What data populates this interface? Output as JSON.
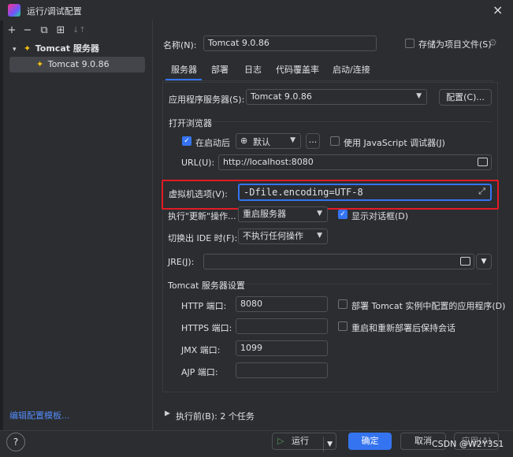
{
  "window": {
    "title": "运行/调试配置",
    "close_icon": "×"
  },
  "sidebar": {
    "toolbar": [
      "+",
      "−",
      "⧉",
      "⊞",
      "↓↑"
    ],
    "group_label": "Tomcat 服务器",
    "item_label": "Tomcat 9.0.86",
    "edit_templates": "编辑配置模板..."
  },
  "header": {
    "name_label": "名称(N):",
    "name_value": "Tomcat 9.0.86",
    "store_label": "存储为项目文件(S)"
  },
  "tabs": [
    "服务器",
    "部署",
    "日志",
    "代码覆盖率",
    "启动/连接"
  ],
  "server": {
    "app_server_label": "应用程序服务器(S):",
    "app_server_value": "Tomcat 9.0.86",
    "configure_btn": "配置(C)...",
    "open_browser_label": "打开浏览器",
    "after_launch_label": "在启动后",
    "browser_value": "默认",
    "more_btn": "...",
    "js_debugger_label": "使用 JavaScript 调试器(J)",
    "url_label": "URL(U):",
    "url_value": "http://localhost:8080",
    "vm_options_label": "虚拟机选项(V):",
    "vm_options_value": "-Dfile.encoding=UTF-8",
    "on_update_label": "执行\"更新\"操作...",
    "on_update_value": "重启服务器",
    "show_dialog_label": "显示对话框(D)",
    "on_frame_label": "切换出 IDE 时(F):",
    "on_frame_value": "不执行任何操作",
    "jre_label": "JRE(J):",
    "jre_value": "",
    "tomcat_settings_label": "Tomcat 服务器设置",
    "http_port_label": "HTTP 端口:",
    "http_port_value": "8080",
    "deploy_apps_label": "部署 Tomcat 实例中配置的应用程序(D)",
    "https_port_label": "HTTPS 端口:",
    "https_port_value": "",
    "preserve_sessions_label": "重启和重新部署后保持会话",
    "jmx_port_label": "JMX 端口:",
    "jmx_port_value": "1099",
    "ajp_port_label": "AJP 端口:",
    "ajp_port_value": ""
  },
  "before_launch": "执行前(B): 2 个任务",
  "footer": {
    "help": "?",
    "run": "运行",
    "ok": "确定",
    "cancel": "取消",
    "apply": "应用(A)"
  },
  "watermark": "CSDN @W2Y3S1",
  "colors": {
    "accent": "#3574f0",
    "highlight_box": "#e21b25",
    "background": "#2b2d30"
  }
}
